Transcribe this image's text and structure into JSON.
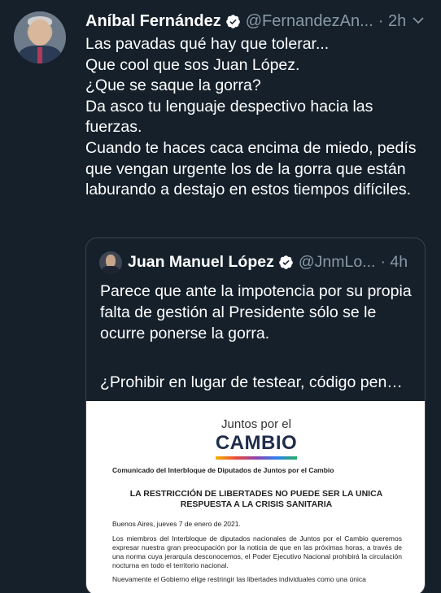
{
  "tweet": {
    "author_name": "Aníbal Fernández",
    "author_handle": "@FernandezAn...",
    "time": "· 2h",
    "body": "Las pavadas qué hay que tolerar...\nQue cool que sos Juan López.\n¿Que se saque la gorra?\nDa asco tu lenguaje despectivo hacia las fuerzas.\nCuando te haces caca encima de miedo, pedís que vengan urgente los de la gorra que están laburando a destajo en estos tiempos difíciles."
  },
  "quoted": {
    "author_name": "Juan Manuel López",
    "author_handle": "@JnmLo...",
    "time": "· 4h",
    "text": "Parece que ante la impotencia por su propia falta de gestión al Presidente sólo se le ocurre ponerse la gorra.",
    "text_truncated": "¿Prohibir en lugar de testear, código pen…"
  },
  "document": {
    "logo_top": "Juntos por el",
    "logo_main": "CAMBIO",
    "subtitle": "Comunicado del Interbloque de Diputados de Juntos por el Cambio",
    "title_line1": "LA RESTRICCIÓN DE LIBERTADES NO PUEDE SER LA UNICA",
    "title_line2": "RESPUESTA A LA CRISIS SANITARIA",
    "date": "Buenos Aires, jueves 7 de enero de 2021.",
    "paragraph1": "Los miembros del Interbloque de diputados nacionales de Juntos por el Cambio queremos expresar nuestra gran preocupación por la noticia de que en las próximas horas, a través de una norma cuya jerarquía desconocemos, el Poder Ejecutivo Nacional prohibirá la circulación nocturna en todo el territorio nacional.",
    "paragraph2": "Nuevamente el Gobierno elige restringir las libertades individuales como una única"
  },
  "icons": {
    "verified": "verified-badge-icon",
    "more": "chevron-down-icon"
  },
  "colors": {
    "background": "#15202b",
    "secondary_text": "#8899a6",
    "border": "#38444d"
  }
}
